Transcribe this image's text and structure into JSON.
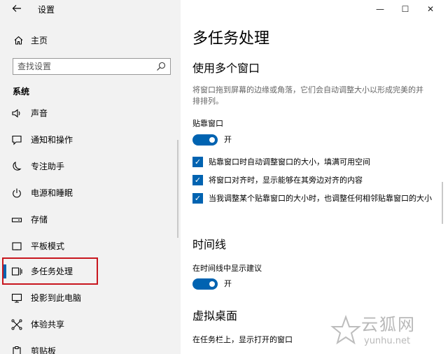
{
  "window": {
    "title": "设置",
    "back_icon": "back-arrow-icon",
    "minimize_glyph": "—",
    "maximize_glyph": "☐",
    "close_glyph": "✕"
  },
  "sidebar": {
    "home_label": "主页",
    "search_placeholder": "查找设置",
    "section_label": "系统",
    "items": [
      {
        "label": "声音",
        "icon": "speaker-icon"
      },
      {
        "label": "通知和操作",
        "icon": "notification-icon"
      },
      {
        "label": "专注助手",
        "icon": "moon-icon"
      },
      {
        "label": "电源和睡眠",
        "icon": "power-icon"
      },
      {
        "label": "存储",
        "icon": "storage-icon"
      },
      {
        "label": "平板模式",
        "icon": "tablet-icon"
      },
      {
        "label": "多任务处理",
        "icon": "multitask-icon",
        "active": true
      },
      {
        "label": "投影到此电脑",
        "icon": "project-icon"
      },
      {
        "label": "体验共享",
        "icon": "share-icon"
      },
      {
        "label": "剪贴板",
        "icon": "clipboard-icon"
      }
    ]
  },
  "main": {
    "page_title": "多任务处理",
    "snap": {
      "heading": "使用多个窗口",
      "description": "将窗口拖到屏幕的边缘或角落，它们会自动调整大小以形成完美的并排排列。",
      "toggle_label": "贴靠窗口",
      "toggle_state": "开",
      "options": [
        "贴靠窗口时自动调整窗口的大小，填满可用空间",
        "将窗口对齐时，显示能够在其旁边对齐的内容",
        "当我调整某个贴靠窗口的大小时，也调整任何相邻贴靠窗口的大小"
      ]
    },
    "timeline": {
      "heading": "时间线",
      "toggle_label": "在时间线中显示建议",
      "toggle_state": "开"
    },
    "desktops": {
      "heading": "虚拟桌面",
      "taskbar_label": "在任务栏上，显示打开的窗口"
    }
  },
  "watermark": {
    "text": "云狐网",
    "url": "yunhu.net"
  },
  "colors": {
    "accent": "#0063b1",
    "highlight": "#c8161e",
    "sidebar_bg": "#f2f2f2"
  }
}
